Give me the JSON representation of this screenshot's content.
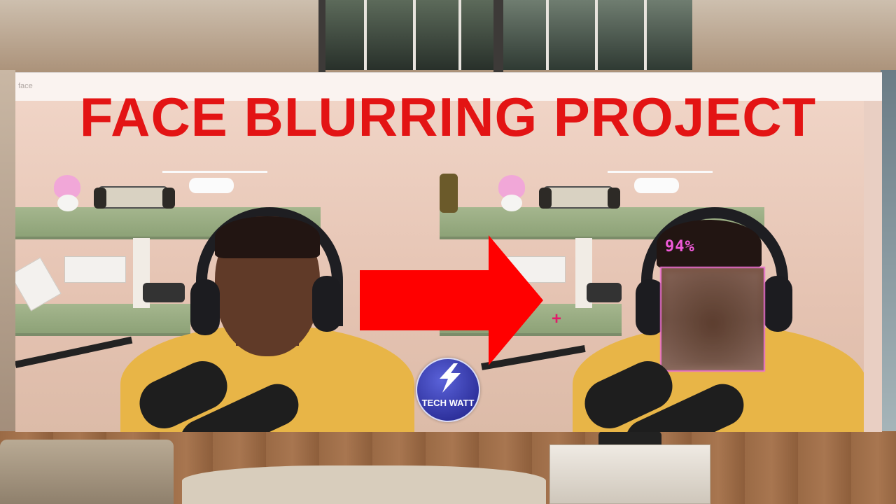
{
  "headline": "FACE BLURRING PROJECT",
  "window": {
    "title": "face"
  },
  "detection": {
    "confidence_label": "94%"
  },
  "logo": {
    "text": "TECH WATT",
    "icon": "lightning-bolt-icon"
  },
  "colors": {
    "headline": "#e31414",
    "arrow": "#ff0000",
    "detection_box": "#ee6fd4",
    "confidence_text": "#f05ad9",
    "logo_bg": "#2c2f9a"
  }
}
